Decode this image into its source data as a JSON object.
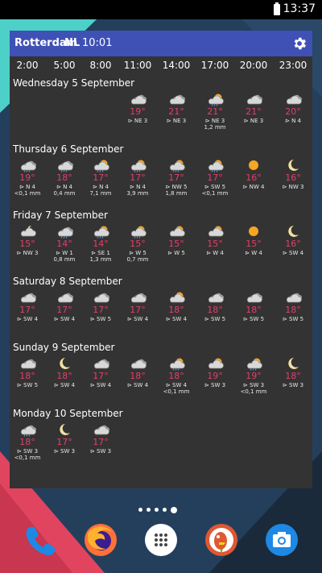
{
  "status_bar": {
    "time": "13:37",
    "battery_icon": "battery-full-icon"
  },
  "widget": {
    "city": "Rotterdam",
    "country": "NL",
    "time": "10:01",
    "settings_icon": "gear-icon",
    "hours": [
      "2:00",
      "5:00",
      "8:00",
      "11:00",
      "14:00",
      "17:00",
      "20:00",
      "23:00"
    ],
    "colors": {
      "header": "#3f51b5",
      "temperature": "#e33f6a",
      "background": "#333333"
    },
    "days": [
      {
        "label": "Wednesday 5 September",
        "slots": [
          null,
          null,
          null,
          {
            "icon": "cloud-icon",
            "temp": "19°",
            "wind": "⊳ NE 3",
            "precip": ""
          },
          {
            "icon": "cloud-icon",
            "temp": "21°",
            "wind": "⊳ NE 3",
            "precip": ""
          },
          {
            "icon": "sun-cloud-rain-icon",
            "temp": "21°",
            "wind": "⊳ NE 3",
            "precip": "1,2 mm"
          },
          {
            "icon": "cloud-icon",
            "temp": "21°",
            "wind": "⊳ NE 3",
            "precip": ""
          },
          {
            "icon": "cloud-icon",
            "temp": "20°",
            "wind": "⊳ N 4",
            "precip": ""
          }
        ]
      },
      {
        "label": "Thursday 6 September",
        "slots": [
          {
            "icon": "cloud-rain-icon",
            "temp": "19°",
            "wind": "⊳ N 4",
            "precip": "<0,1 mm"
          },
          {
            "icon": "cloud-rain-icon",
            "temp": "18°",
            "wind": "⊳ N 4",
            "precip": "0,4 mm"
          },
          {
            "icon": "sun-cloud-rain-icon",
            "temp": "17°",
            "wind": "⊳ N 4",
            "precip": "7,1 mm"
          },
          {
            "icon": "sun-cloud-rain-icon",
            "temp": "17°",
            "wind": "⊳ N 4",
            "precip": "3,9 mm"
          },
          {
            "icon": "sun-cloud-rain-icon",
            "temp": "17°",
            "wind": "⊳ NW 5",
            "precip": "1,8 mm"
          },
          {
            "icon": "sun-cloud-rain-icon",
            "temp": "17°",
            "wind": "⊳ SW 5",
            "precip": "<0,1 mm"
          },
          {
            "icon": "sun-icon",
            "temp": "16°",
            "wind": "⊳ NW 4",
            "precip": ""
          },
          {
            "icon": "moon-icon",
            "temp": "16°",
            "wind": "⊳ NW 3",
            "precip": ""
          }
        ]
      },
      {
        "label": "Friday 7 September",
        "slots": [
          {
            "icon": "moon-cloud-icon",
            "temp": "15°",
            "wind": "⊳ NW 3",
            "precip": ""
          },
          {
            "icon": "cloud-rain-icon",
            "temp": "14°",
            "wind": "⊳ W 1",
            "precip": "0,8 mm"
          },
          {
            "icon": "sun-cloud-rain-icon",
            "temp": "14°",
            "wind": "⊳ SE 1",
            "precip": "1,3 mm"
          },
          {
            "icon": "sun-cloud-rain-icon",
            "temp": "15°",
            "wind": "⊳ W 5",
            "precip": "0,7 mm"
          },
          {
            "icon": "sun-cloud-icon",
            "temp": "15°",
            "wind": "⊳ W 5",
            "precip": ""
          },
          {
            "icon": "sun-cloud-icon",
            "temp": "15°",
            "wind": "⊳ W 4",
            "precip": ""
          },
          {
            "icon": "sun-icon",
            "temp": "15°",
            "wind": "⊳ W 4",
            "precip": ""
          },
          {
            "icon": "moon-icon",
            "temp": "16°",
            "wind": "⊳ SW 4",
            "precip": ""
          }
        ]
      },
      {
        "label": "Saturday 8 September",
        "slots": [
          {
            "icon": "cloud-icon",
            "temp": "17°",
            "wind": "⊳ SW 4",
            "precip": ""
          },
          {
            "icon": "cloud-icon",
            "temp": "17°",
            "wind": "⊳ SW 4",
            "precip": ""
          },
          {
            "icon": "cloud-icon",
            "temp": "17°",
            "wind": "⊳ SW 5",
            "precip": ""
          },
          {
            "icon": "cloud-icon",
            "temp": "17°",
            "wind": "⊳ SW 4",
            "precip": ""
          },
          {
            "icon": "sun-cloud-icon",
            "temp": "18°",
            "wind": "⊳ SW 4",
            "precip": ""
          },
          {
            "icon": "cloud-icon",
            "temp": "18°",
            "wind": "⊳ SW 5",
            "precip": ""
          },
          {
            "icon": "cloud-icon",
            "temp": "18°",
            "wind": "⊳ SW 5",
            "precip": ""
          },
          {
            "icon": "cloud-icon",
            "temp": "18°",
            "wind": "⊳ SW 5",
            "precip": ""
          }
        ]
      },
      {
        "label": "Sunday 9 September",
        "slots": [
          {
            "icon": "cloud-icon",
            "temp": "18°",
            "wind": "⊳ SW 5",
            "precip": ""
          },
          {
            "icon": "moon-icon",
            "temp": "18°",
            "wind": "⊳ SW 4",
            "precip": ""
          },
          {
            "icon": "cloud-icon",
            "temp": "17°",
            "wind": "⊳ SW 4",
            "precip": ""
          },
          {
            "icon": "cloud-icon",
            "temp": "18°",
            "wind": "⊳ SW 4",
            "precip": ""
          },
          {
            "icon": "sun-cloud-rain-icon",
            "temp": "18°",
            "wind": "⊳ SW 4",
            "precip": "<0,1 mm"
          },
          {
            "icon": "sun-cloud-icon",
            "temp": "19°",
            "wind": "⊳ SW 3",
            "precip": ""
          },
          {
            "icon": "sun-cloud-rain-icon",
            "temp": "19°",
            "wind": "⊳ SW 3",
            "precip": "<0,1 mm"
          },
          {
            "icon": "moon-icon",
            "temp": "18°",
            "wind": "⊳ SW 3",
            "precip": ""
          }
        ]
      },
      {
        "label": "Monday 10 September",
        "slots": [
          {
            "icon": "cloud-rain-icon",
            "temp": "18°",
            "wind": "⊳ SW 3",
            "precip": "<0,1 mm"
          },
          {
            "icon": "moon-icon",
            "temp": "17°",
            "wind": "⊳ SW 3",
            "precip": ""
          },
          {
            "icon": "cloud-icon",
            "temp": "17°",
            "wind": "⊳ SW 3",
            "precip": ""
          },
          null,
          null,
          null,
          null,
          null
        ]
      }
    ]
  },
  "home": {
    "page_count": 5,
    "active_page": 5,
    "dock": [
      "phone-icon",
      "firefox-icon",
      "app-drawer-icon",
      "duckduckgo-icon",
      "camera-icon"
    ]
  }
}
